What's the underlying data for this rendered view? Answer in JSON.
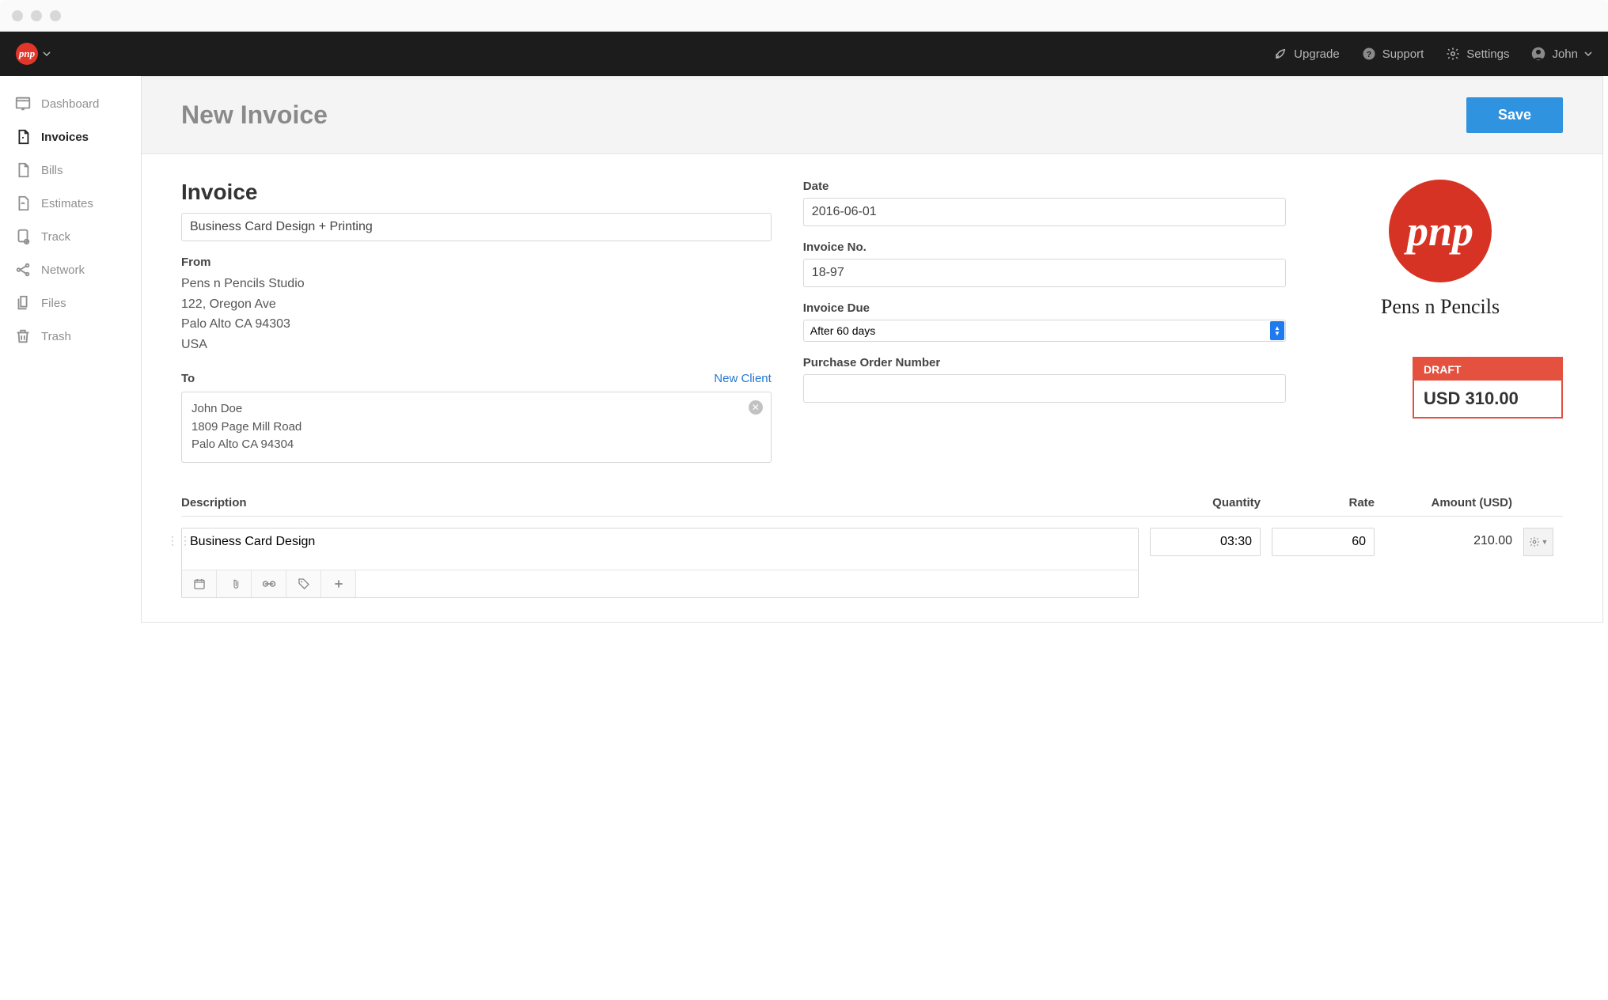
{
  "topbar": {
    "brand_short": "pnp",
    "upgrade": "Upgrade",
    "support": "Support",
    "settings": "Settings",
    "user": "John"
  },
  "sidebar": {
    "items": [
      {
        "label": "Dashboard"
      },
      {
        "label": "Invoices"
      },
      {
        "label": "Bills"
      },
      {
        "label": "Estimates"
      },
      {
        "label": "Track"
      },
      {
        "label": "Network"
      },
      {
        "label": "Files"
      },
      {
        "label": "Trash"
      }
    ]
  },
  "page": {
    "title": "New Invoice",
    "save": "Save"
  },
  "invoice": {
    "heading": "Invoice",
    "subject": "Business Card Design + Printing",
    "from_label": "From",
    "from": {
      "name": "Pens n Pencils Studio",
      "line1": "122, Oregon Ave",
      "line2": "Palo Alto CA 94303",
      "country": "USA"
    },
    "to_label": "To",
    "new_client": "New Client",
    "to": {
      "name": "John Doe",
      "line1": "1809 Page Mill Road",
      "line2": "Palo Alto CA 94304"
    },
    "date_label": "Date",
    "date": "2016-06-01",
    "number_label": "Invoice No.",
    "number": "18-97",
    "due_label": "Invoice Due",
    "due_value": "After 60 days",
    "po_label": "Purchase Order Number",
    "po_value": "",
    "brand_logo_text": "pnp",
    "brand_name": "Pens n Pencils",
    "status": "DRAFT",
    "total": "USD 310.00"
  },
  "columns": {
    "desc": "Description",
    "qty": "Quantity",
    "rate": "Rate",
    "amount": "Amount (USD)"
  },
  "items": [
    {
      "desc": "Business Card Design",
      "qty": "03:30",
      "rate": "60",
      "amount": "210.00"
    }
  ]
}
